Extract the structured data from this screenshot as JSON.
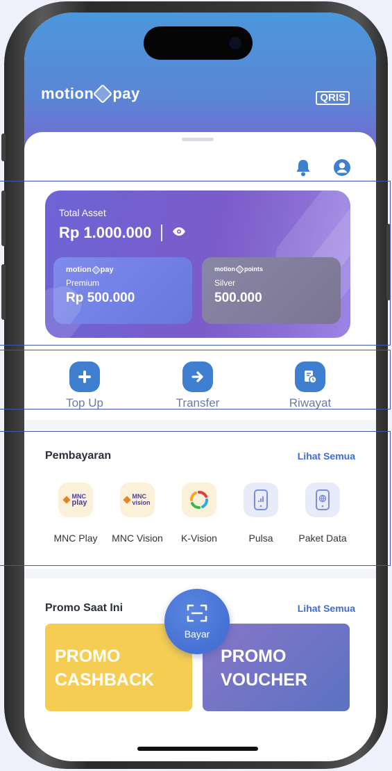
{
  "app": {
    "brand": "motion",
    "brand_suffix": "pay",
    "qris_label": "QRIS"
  },
  "header_icons": [
    "bell-icon",
    "user-icon"
  ],
  "asset": {
    "label": "Total Asset",
    "value": "Rp 1.000.000",
    "motionpay": {
      "brand": "motion",
      "brand_suffix": "pay",
      "tier": "Premium",
      "value": "Rp 500.000"
    },
    "points": {
      "brand": "motion",
      "brand_suffix": "points",
      "tier": "Silver",
      "value": "500.000"
    }
  },
  "actions": [
    {
      "label": "Top Up",
      "icon": "plus-icon"
    },
    {
      "label": "Transfer",
      "icon": "arrow-right-icon"
    },
    {
      "label": "Riwayat",
      "icon": "history-icon"
    }
  ],
  "payments": {
    "title": "Pembayaran",
    "see_all": "Lihat Semua",
    "items": [
      {
        "label": "MNC Play",
        "logo_top": "MNC",
        "logo_bottom": "play"
      },
      {
        "label": "MNC Vision",
        "logo_top": "MNC",
        "logo_bottom": "vision"
      },
      {
        "label": "K-Vision",
        "icon": "k-vision-icon"
      },
      {
        "label": "Pulsa",
        "icon": "phone-signal-icon"
      },
      {
        "label": "Paket Data",
        "icon": "phone-globe-icon"
      }
    ]
  },
  "promo": {
    "title": "Promo Saat Ini",
    "see_all": "Lihat Semua",
    "cards": [
      {
        "line1": "PROMO",
        "line2": "CASHBACK",
        "color": "#f4cd52"
      },
      {
        "line1": "PROMO",
        "line2": "VOUCHER",
        "color": "#6a72c4"
      }
    ]
  },
  "bayar": {
    "label": "Bayar",
    "icon": "scan-icon"
  },
  "colors": {
    "primary": "#3e7fcf",
    "accent_link": "#3e6dd0",
    "header_top": "#4b97dc",
    "header_bottom": "#7a62cf"
  }
}
